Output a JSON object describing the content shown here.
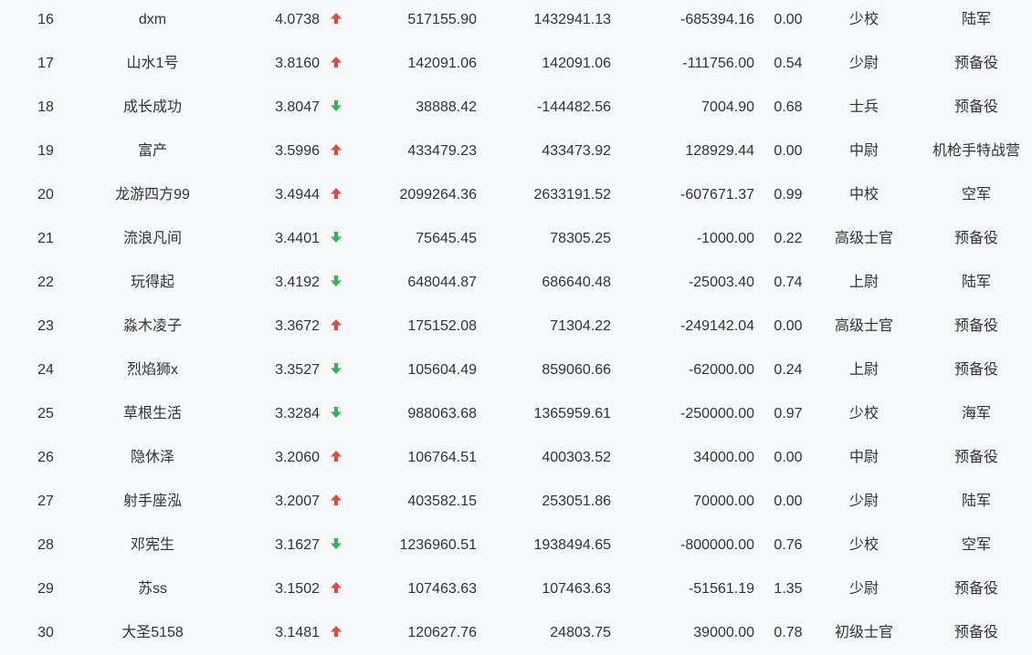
{
  "colors": {
    "up": "#e64646",
    "down": "#2fb84f",
    "text": "#333333",
    "background": "#f7f8fa"
  },
  "rows": [
    {
      "rank": "16",
      "name": "dxm",
      "score": "4.0738",
      "trend": "up",
      "trend_icon": "arrow-up-icon",
      "v1": "517155.90",
      "v2": "1432941.13",
      "v3": "-685394.16",
      "ratio": "0.00",
      "military_rank": "少校",
      "branch": "陆军"
    },
    {
      "rank": "17",
      "name": "山水1号",
      "score": "3.8160",
      "trend": "up",
      "trend_icon": "arrow-up-icon",
      "v1": "142091.06",
      "v2": "142091.06",
      "v3": "-111756.00",
      "ratio": "0.54",
      "military_rank": "少尉",
      "branch": "预备役"
    },
    {
      "rank": "18",
      "name": "成长成功",
      "score": "3.8047",
      "trend": "down",
      "trend_icon": "arrow-down-icon",
      "v1": "38888.42",
      "v2": "-144482.56",
      "v3": "7004.90",
      "ratio": "0.68",
      "military_rank": "士兵",
      "branch": "预备役"
    },
    {
      "rank": "19",
      "name": "富产",
      "score": "3.5996",
      "trend": "up",
      "trend_icon": "arrow-up-icon",
      "v1": "433479.23",
      "v2": "433473.92",
      "v3": "128929.44",
      "ratio": "0.00",
      "military_rank": "中尉",
      "branch": "机枪手特战营"
    },
    {
      "rank": "20",
      "name": "龙游四方99",
      "score": "3.4944",
      "trend": "up",
      "trend_icon": "arrow-up-icon",
      "v1": "2099264.36",
      "v2": "2633191.52",
      "v3": "-607671.37",
      "ratio": "0.99",
      "military_rank": "中校",
      "branch": "空军"
    },
    {
      "rank": "21",
      "name": "流浪凡间",
      "score": "3.4401",
      "trend": "down",
      "trend_icon": "arrow-down-icon",
      "v1": "75645.45",
      "v2": "78305.25",
      "v3": "-1000.00",
      "ratio": "0.22",
      "military_rank": "高级士官",
      "branch": "预备役"
    },
    {
      "rank": "22",
      "name": "玩得起",
      "score": "3.4192",
      "trend": "down",
      "trend_icon": "arrow-down-icon",
      "v1": "648044.87",
      "v2": "686640.48",
      "v3": "-25003.40",
      "ratio": "0.74",
      "military_rank": "上尉",
      "branch": "陆军"
    },
    {
      "rank": "23",
      "name": "淼木凌子",
      "score": "3.3672",
      "trend": "up",
      "trend_icon": "arrow-up-icon",
      "v1": "175152.08",
      "v2": "71304.22",
      "v3": "-249142.04",
      "ratio": "0.00",
      "military_rank": "高级士官",
      "branch": "预备役"
    },
    {
      "rank": "24",
      "name": "烈焰狮x",
      "score": "3.3527",
      "trend": "down",
      "trend_icon": "arrow-down-icon",
      "v1": "105604.49",
      "v2": "859060.66",
      "v3": "-62000.00",
      "ratio": "0.24",
      "military_rank": "上尉",
      "branch": "预备役"
    },
    {
      "rank": "25",
      "name": "草根生活",
      "score": "3.3284",
      "trend": "down",
      "trend_icon": "arrow-down-icon",
      "v1": "988063.68",
      "v2": "1365959.61",
      "v3": "-250000.00",
      "ratio": "0.97",
      "military_rank": "少校",
      "branch": "海军"
    },
    {
      "rank": "26",
      "name": "隐休泽",
      "score": "3.2060",
      "trend": "up",
      "trend_icon": "arrow-up-icon",
      "v1": "106764.51",
      "v2": "400303.52",
      "v3": "34000.00",
      "ratio": "0.00",
      "military_rank": "中尉",
      "branch": "预备役"
    },
    {
      "rank": "27",
      "name": "射手座泓",
      "score": "3.2007",
      "trend": "up",
      "trend_icon": "arrow-up-icon",
      "v1": "403582.15",
      "v2": "253051.86",
      "v3": "70000.00",
      "ratio": "0.00",
      "military_rank": "少尉",
      "branch": "陆军"
    },
    {
      "rank": "28",
      "name": "邓宪生",
      "score": "3.1627",
      "trend": "down",
      "trend_icon": "arrow-down-icon",
      "v1": "1236960.51",
      "v2": "1938494.65",
      "v3": "-800000.00",
      "ratio": "0.76",
      "military_rank": "少校",
      "branch": "空军"
    },
    {
      "rank": "29",
      "name": "苏ss",
      "score": "3.1502",
      "trend": "up",
      "trend_icon": "arrow-up-icon",
      "v1": "107463.63",
      "v2": "107463.63",
      "v3": "-51561.19",
      "ratio": "1.35",
      "military_rank": "少尉",
      "branch": "预备役"
    },
    {
      "rank": "30",
      "name": "大圣5158",
      "score": "3.1481",
      "trend": "up",
      "trend_icon": "arrow-up-icon",
      "v1": "120627.76",
      "v2": "24803.75",
      "v3": "39000.00",
      "ratio": "0.78",
      "military_rank": "初级士官",
      "branch": "预备役"
    }
  ]
}
